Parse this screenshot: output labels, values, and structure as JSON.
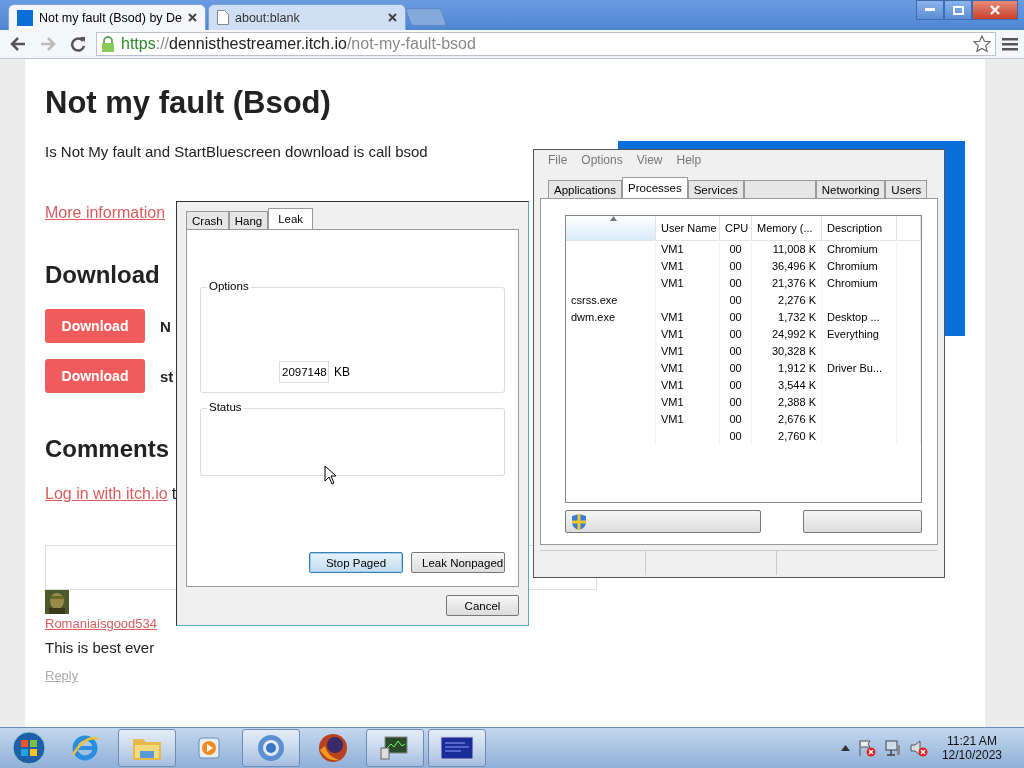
{
  "browser": {
    "tabs": [
      {
        "title": "Not my fault (Bsod) by De",
        "selected": true,
        "kind": "site"
      },
      {
        "title": "about:blank",
        "selected": false,
        "kind": "blank"
      }
    ],
    "back_disabled": false,
    "forward_disabled": true,
    "url": {
      "scheme": "https",
      "separator": "://",
      "host": "dennisthestreamer.itch.io",
      "path": "/not-my-fault-bsod"
    }
  },
  "page": {
    "title": "Not my fault (Bsod)",
    "description": "Is Not My fault and StartBluescreen download is call bsod",
    "more_link": "More information",
    "download_heading": "Download",
    "downloads": [
      {
        "button": "Download",
        "file": "N"
      },
      {
        "button": "Download",
        "file": "st"
      }
    ],
    "comments_heading": "Comments",
    "login_link": "Log in with itch.io",
    "login_rest": "t",
    "comment": {
      "author": "Romaniaisgood534",
      "body": "This is best ever",
      "reply": "Reply"
    }
  },
  "leak_dialog": {
    "tabs": [
      {
        "label": "Crash",
        "selected": false
      },
      {
        "label": "Hang",
        "selected": false
      },
      {
        "label": "Leak",
        "selected": true
      }
    ],
    "options_label": "Options",
    "size_value": "2097148",
    "size_unit": "KB",
    "status_label": "Status",
    "buttons": [
      {
        "label": "Stop Paged",
        "default": true
      },
      {
        "label": "Leak Nonpaged",
        "default": false
      }
    ],
    "cancel": "Cancel"
  },
  "task_manager": {
    "menu": [
      "File",
      "Options",
      "View",
      "Help"
    ],
    "tabs": [
      {
        "label": "Applications",
        "selected": false
      },
      {
        "label": "Processes",
        "selected": true
      },
      {
        "label": "Services",
        "selected": false
      },
      {
        "selected": false
      },
      {
        "label": "Networking",
        "selected": false
      },
      {
        "label": "Users",
        "selected": false
      }
    ],
    "columns": [
      "User Name",
      "CPU",
      "Memory (...",
      "Description"
    ],
    "rows": [
      {
        "name": "",
        "user": "VM1",
        "cpu": "00",
        "memory": "11,008 K",
        "description": "Chromium"
      },
      {
        "name": "",
        "user": "VM1",
        "cpu": "00",
        "memory": "36,496 K",
        "description": "Chromium"
      },
      {
        "name": "",
        "user": "VM1",
        "cpu": "00",
        "memory": "21,376 K",
        "description": "Chromium"
      },
      {
        "name": "csrss.exe",
        "user": "",
        "cpu": "00",
        "memory": "2,276 K",
        "description": ""
      },
      {
        "name": "dwm.exe",
        "user": "VM1",
        "cpu": "00",
        "memory": "1,732 K",
        "description": "Desktop ..."
      },
      {
        "name": "",
        "user": "VM1",
        "cpu": "00",
        "memory": "24,992 K",
        "description": "Everything"
      },
      {
        "name": "",
        "user": "VM1",
        "cpu": "00",
        "memory": "30,328 K",
        "description": ""
      },
      {
        "name": "",
        "user": "VM1",
        "cpu": "00",
        "memory": "1,912 K",
        "description": "Driver Bu..."
      },
      {
        "name": "",
        "user": "VM1",
        "cpu": "00",
        "memory": "3,544 K",
        "description": ""
      },
      {
        "name": "",
        "user": "VM1",
        "cpu": "00",
        "memory": "2,388 K",
        "description": ""
      },
      {
        "name": "",
        "user": "VM1",
        "cpu": "00",
        "memory": "2,676 K",
        "description": ""
      },
      {
        "name": "",
        "user": "",
        "cpu": "00",
        "memory": "2,760 K",
        "description": ""
      }
    ]
  },
  "taskbar": {
    "items": [
      {
        "kind": "ie",
        "running": false
      },
      {
        "kind": "folder",
        "running": true
      },
      {
        "kind": "media",
        "running": false
      },
      {
        "kind": "chromium",
        "running": true
      },
      {
        "kind": "firefox",
        "running": false
      },
      {
        "kind": "monitor",
        "running": true
      },
      {
        "kind": "bluescreen",
        "running": true
      }
    ],
    "time": "11:21 AM",
    "date": "12/10/2023"
  }
}
